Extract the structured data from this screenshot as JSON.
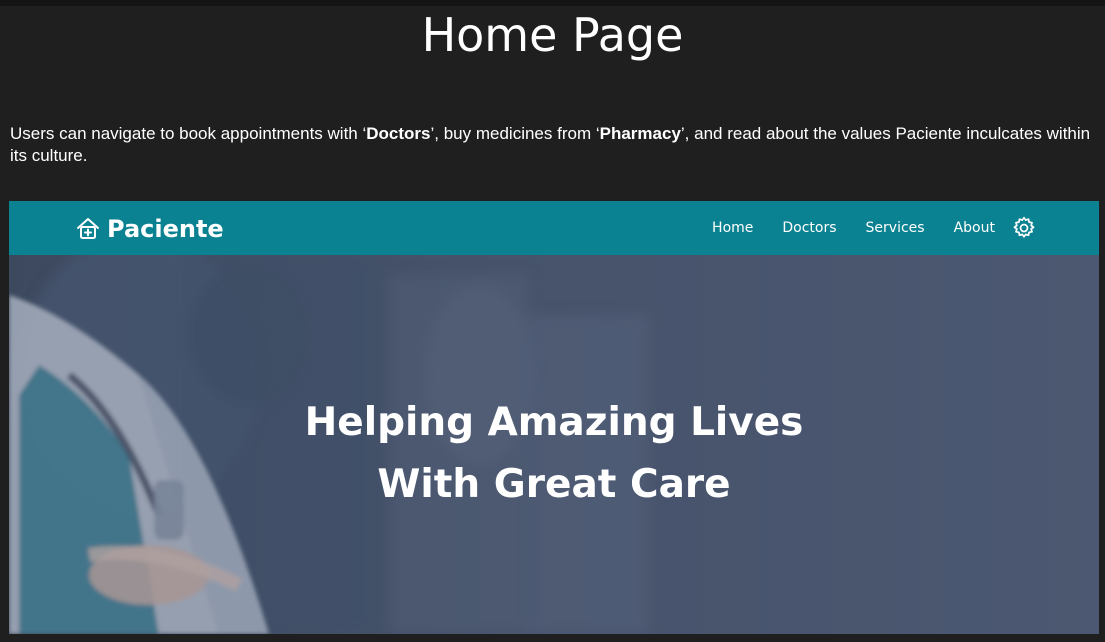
{
  "slide": {
    "title": "Home Page",
    "description": {
      "part1": "Users can navigate to book appointments with ‘",
      "bold1": "Doctors",
      "part2": "’, buy medicines from ‘",
      "bold2": "Pharmacy",
      "part3": "’, and read about the values Paciente inculcates within its culture."
    }
  },
  "site": {
    "brand": {
      "name": "Paciente",
      "icon": "hospital-plus-icon"
    },
    "nav": {
      "items": [
        {
          "label": "Home"
        },
        {
          "label": "Doctors"
        },
        {
          "label": "Services"
        },
        {
          "label": "About"
        }
      ],
      "settings_icon": "gear-icon"
    },
    "hero": {
      "line1": "Helping Amazing Lives",
      "line2": "With Great Care"
    },
    "colors": {
      "navbar": "#0b8291",
      "background": "#1f1f1f",
      "hero_overlay": "#4a5668"
    }
  }
}
